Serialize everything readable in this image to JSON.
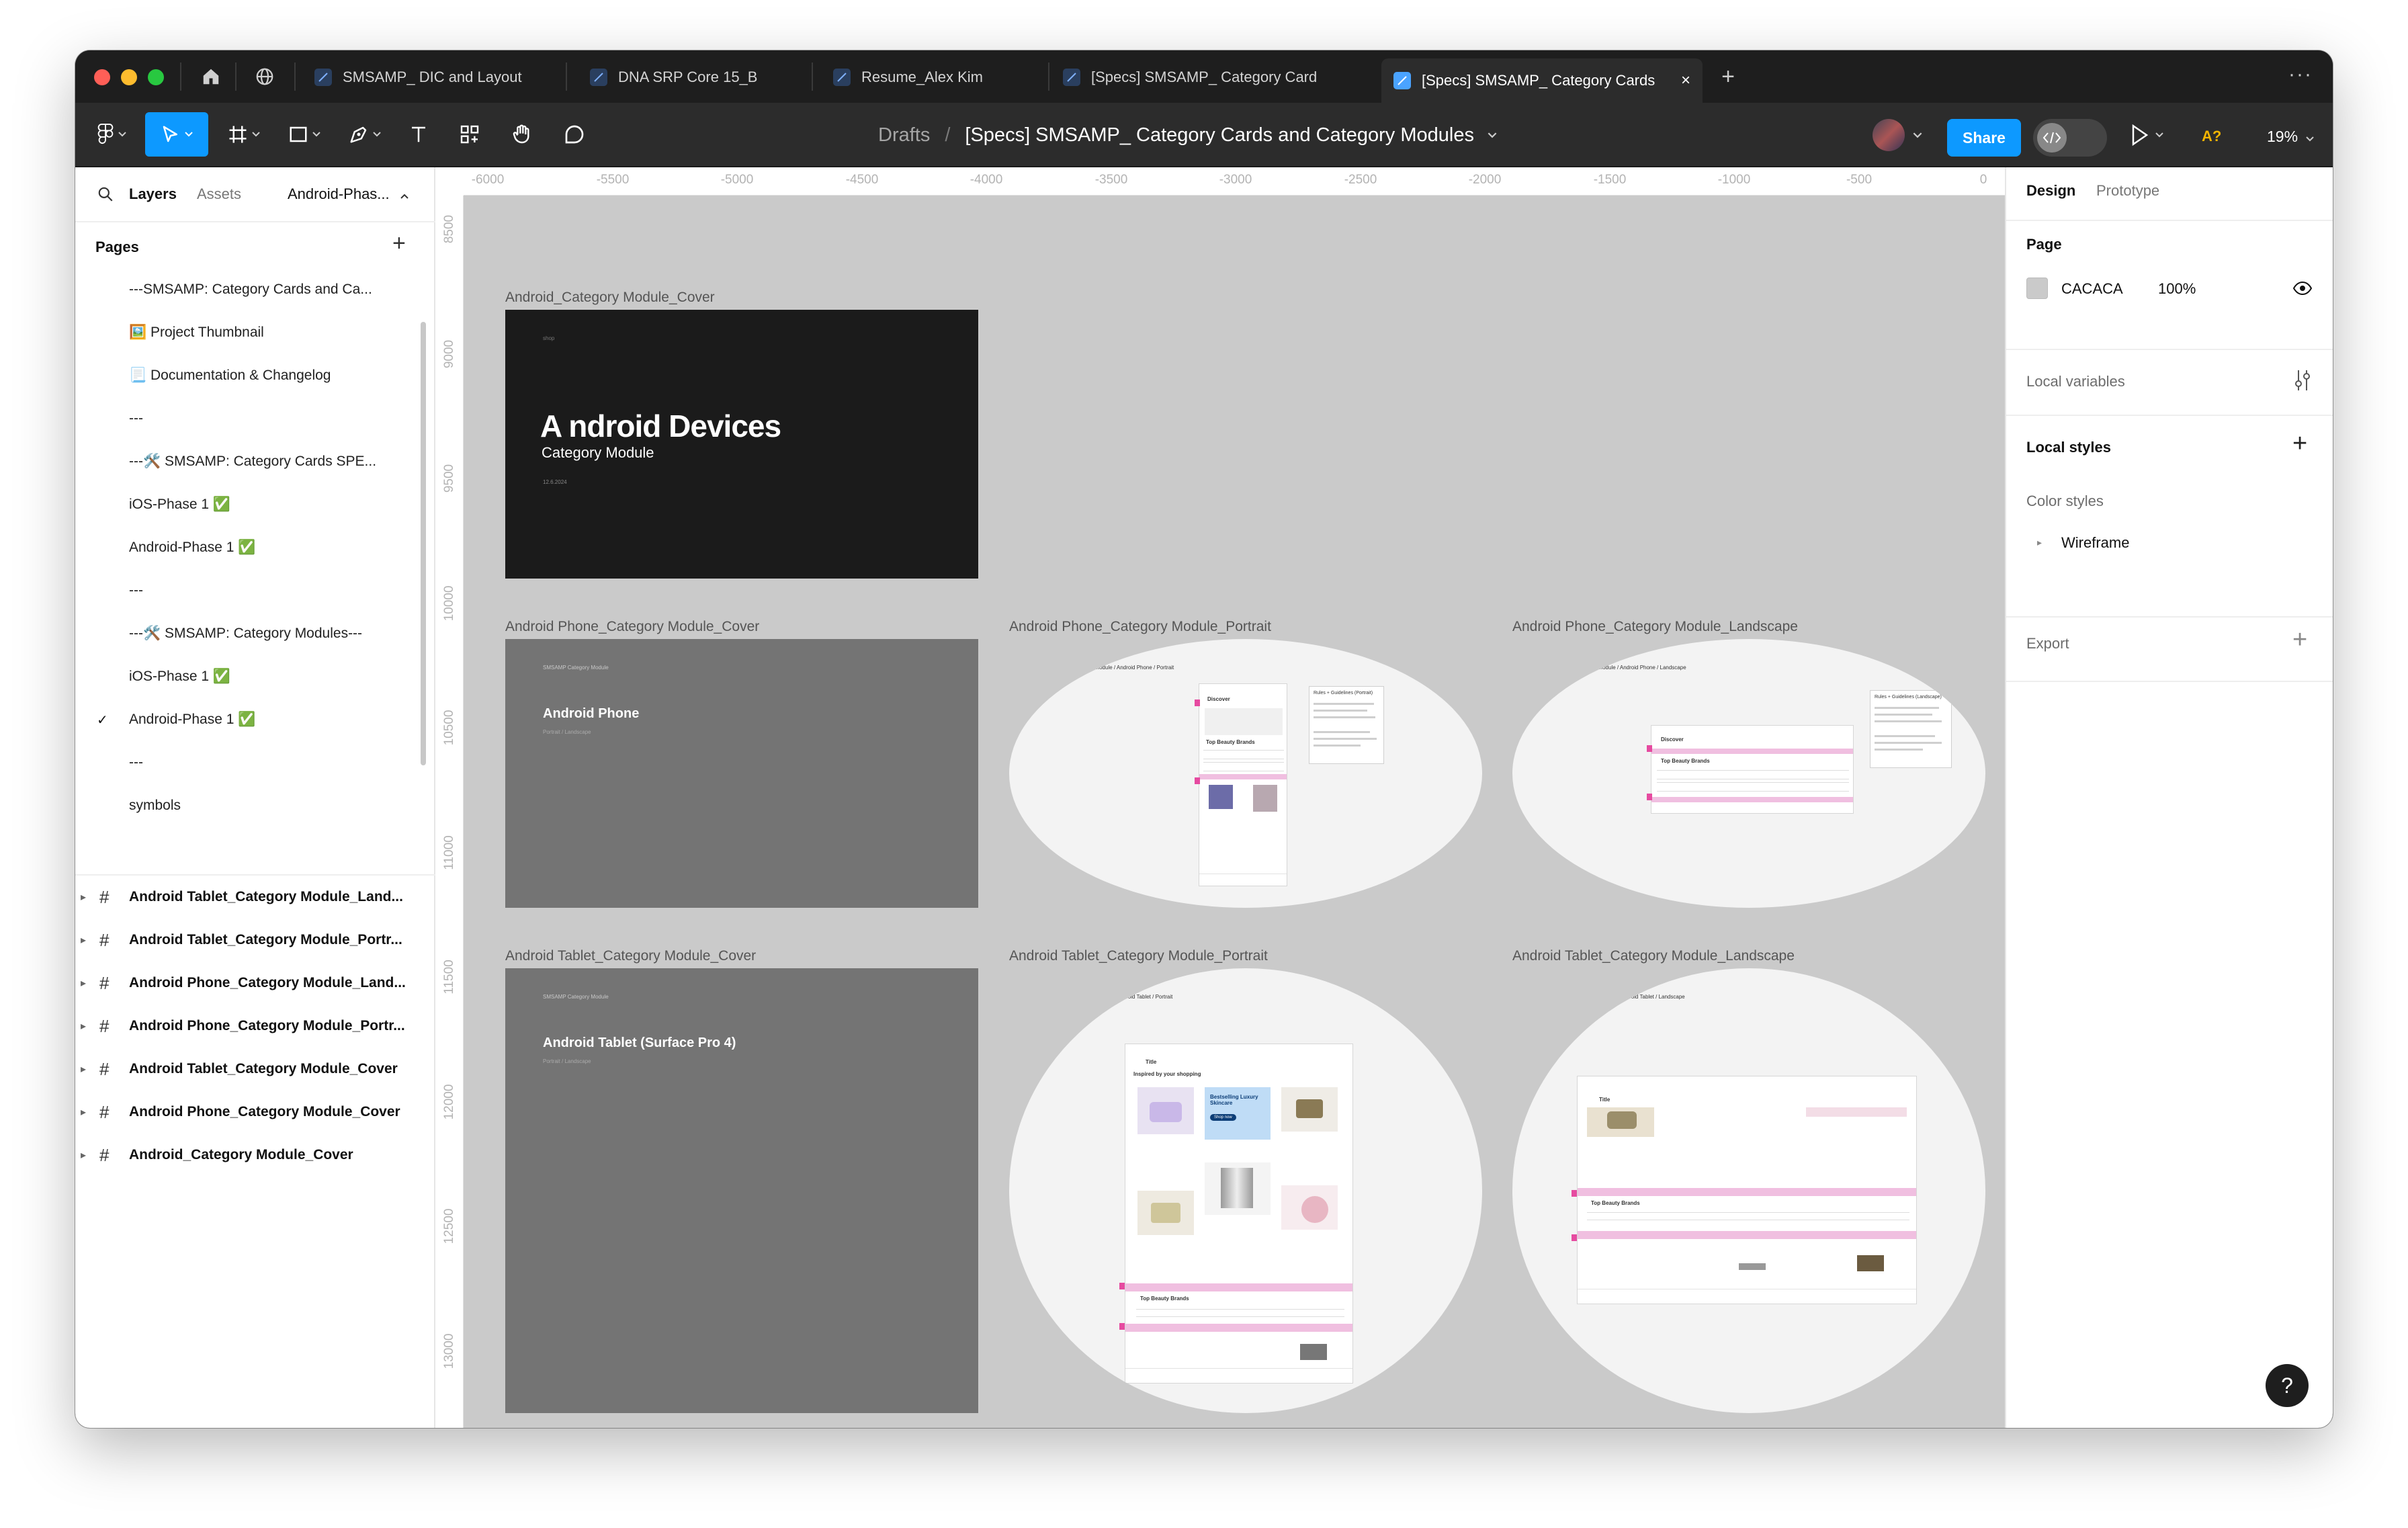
{
  "window": {
    "tabs": [
      {
        "label": "SMSAMP_ DIC and Layout"
      },
      {
        "label": "DNA SRP Core 15_B"
      },
      {
        "label": "Resume_Alex Kim"
      },
      {
        "label": "[Specs] SMSAMP_ Category Card Co"
      },
      {
        "label": "[Specs] SMSAMP_ Category Cards",
        "active": true
      }
    ],
    "new_tab": "+",
    "more": "···"
  },
  "toolbar": {
    "breadcrumb_root": "Drafts",
    "breadcrumb_sep": "/",
    "file_name": "[Specs] SMSAMP_ Category Cards and Category Modules",
    "share_label": "Share",
    "a11y_badge": "A?",
    "zoom": "19%",
    "tools": [
      "figma-menu-icon",
      "move-icon",
      "frame-icon",
      "rectangle-icon",
      "pen-icon",
      "text-icon",
      "components-icon",
      "hand-icon",
      "comment-icon"
    ]
  },
  "left_panel": {
    "tabs": {
      "layers": "Layers",
      "assets": "Assets"
    },
    "current_page": "Android-Phas...",
    "pages_title": "Pages",
    "add_page": "+",
    "pages": [
      {
        "label": "---SMSAMP: Category Cards and Ca..."
      },
      {
        "label": "🖼️ Project Thumbnail"
      },
      {
        "label": "📃 Documentation & Changelog"
      },
      {
        "label": "---"
      },
      {
        "label": "---🛠️ SMSAMP: Category Cards SPE..."
      },
      {
        "label": "iOS-Phase 1 ✅"
      },
      {
        "label": "Android-Phase 1 ✅"
      },
      {
        "label": "---"
      },
      {
        "label": "---🛠️ SMSAMP: Category Modules---"
      },
      {
        "label": "iOS-Phase 1 ✅"
      },
      {
        "label": "Android-Phase 1 ✅",
        "selected": true
      },
      {
        "label": "---"
      },
      {
        "label": "symbols"
      }
    ],
    "layers": [
      {
        "label": "Android Tablet_Category Module_Land..."
      },
      {
        "label": "Android Tablet_Category Module_Portr..."
      },
      {
        "label": "Android Phone_Category Module_Land..."
      },
      {
        "label": "Android Phone_Category Module_Portr..."
      },
      {
        "label": "Android Tablet_Category Module_Cover"
      },
      {
        "label": "Android Phone_Category Module_Cover"
      },
      {
        "label": "Android_Category Module_Cover"
      }
    ]
  },
  "canvas": {
    "ruler_x": [
      "-6000",
      "-5500",
      "-5000",
      "-4500",
      "-4000",
      "-3500",
      "-3000",
      "-2500",
      "-2000",
      "-1500",
      "-1000",
      "-500",
      "0"
    ],
    "ruler_y": [
      "8500",
      "9000",
      "9500",
      "10000",
      "10500",
      "11000",
      "11500",
      "12000",
      "12500",
      "13000"
    ],
    "frames": {
      "cover": {
        "label": "Android_Category Module_Cover",
        "title": "A ndroid Devices",
        "subtitle": "Category Module",
        "tiny_top": "shop",
        "date": "12.6.2024"
      },
      "phone_cover": {
        "label": "Android Phone_Category Module_Cover",
        "kicker": "SMSAMP Category Module",
        "title": "Android Phone",
        "sub": "Portrait / Landscape"
      },
      "phone_portrait": {
        "label": "Android Phone_Category Module_Portrait",
        "path": "SMSAMP Category Module / Android Phone / Portrait",
        "screen_title": "Discover",
        "section": "Top Beauty Brands",
        "note_title": "Rules + Guidelines (Portrait)"
      },
      "phone_landscape": {
        "label": "Android Phone_Category Module_Landscape",
        "path": "SMSAMP Category Module / Android Phone / Landscape",
        "screen_title": "Discover",
        "section": "Top Beauty Brands",
        "note_title": "Rules + Guidelines (Landscape)"
      },
      "tablet_cover": {
        "label": "Android Tablet_Category Module_Cover",
        "kicker": "SMSAMP Category Module",
        "title": "Android Tablet (Surface Pro 4)",
        "sub": "Portrait / Landscape"
      },
      "tablet_portrait": {
        "label": "Android Tablet_Category Module_Portrait",
        "path": "SMSAMP Category Module / Android Tablet / Portrait",
        "screen_title": "Title",
        "inspired": "Inspired by your shopping",
        "promo": "Bestselling Luxury Skincare",
        "promo_btn": "Shop now",
        "section": "Top Beauty Brands"
      },
      "tablet_landscape": {
        "label": "Android Tablet_Category Module_Landscape",
        "path": "SMSAMP Category Module / Android Tablet / Landscape",
        "screen_title": "Title",
        "section": "Top Beauty Brands"
      }
    }
  },
  "right_panel": {
    "tabs": {
      "design": "Design",
      "prototype": "Prototype"
    },
    "page_title": "Page",
    "page_color": "CACACA",
    "page_opacity": "100%",
    "local_variables": "Local variables",
    "local_styles": "Local styles",
    "color_styles": "Color styles",
    "style_item": "Wireframe",
    "export": "Export",
    "colors": {
      "swatch": "#cacaca"
    }
  },
  "help": "?"
}
